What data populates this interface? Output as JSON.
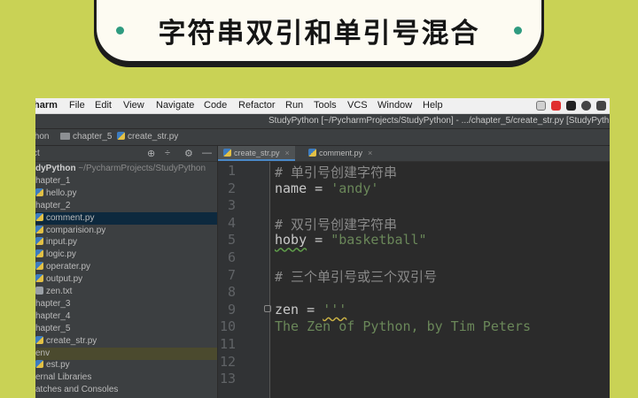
{
  "banner": {
    "title": "字符串双引和单引号混合"
  },
  "menubar": {
    "app": "harm",
    "items": [
      "File",
      "Edit",
      "View",
      "Navigate",
      "Code",
      "Refactor",
      "Run",
      "Tools",
      "VCS",
      "Window",
      "Help"
    ],
    "tray_colors": [
      "#d0d0d0",
      "#e03030",
      "#222222",
      "#444444",
      "#444444"
    ]
  },
  "titlebar": {
    "text": "StudyPython [~/PycharmProjects/StudyPython] - .../chapter_5/create_str.py [StudyPyth"
  },
  "navbar": {
    "crumbs": [
      "thon",
      "chapter_5",
      "create_str.py"
    ]
  },
  "project": {
    "label": "ct",
    "tree": [
      {
        "text": "dyPython",
        "extra": " ~/PycharmProjects/StudyPython",
        "root": true
      },
      {
        "text": "hapter_1",
        "icon": "folder"
      },
      {
        "text": "hello.py",
        "icon": "py"
      },
      {
        "text": "hapter_2",
        "icon": "folder"
      },
      {
        "text": "comment.py",
        "icon": "py",
        "selected": true
      },
      {
        "text": "comparision.py",
        "icon": "py"
      },
      {
        "text": "input.py",
        "icon": "py"
      },
      {
        "text": "logic.py",
        "icon": "py"
      },
      {
        "text": "operater.py",
        "icon": "py"
      },
      {
        "text": "output.py",
        "icon": "py"
      },
      {
        "text": "zen.txt",
        "icon": "txt"
      },
      {
        "text": "hapter_3",
        "icon": "folder"
      },
      {
        "text": "hapter_4",
        "icon": "folder"
      },
      {
        "text": "hapter_5",
        "icon": "folder"
      },
      {
        "text": "create_str.py",
        "icon": "py"
      },
      {
        "text": "env",
        "venv": true
      },
      {
        "text": "est.py",
        "icon": "py"
      },
      {
        "text": "ernal Libraries"
      },
      {
        "text": "atches and Consoles"
      }
    ]
  },
  "tabs": [
    {
      "label": "create_str.py",
      "active": true
    },
    {
      "label": "comment.py",
      "active": false
    }
  ],
  "editor": {
    "line_numbers": [
      "1",
      "2",
      "3",
      "4",
      "5",
      "6",
      "7",
      "8",
      "9",
      "10",
      "11",
      "12",
      "13"
    ],
    "lines": [
      {
        "parts": [
          {
            "t": "# 单引号创建字符串",
            "c": "c-com"
          }
        ]
      },
      {
        "parts": [
          {
            "t": "name = ",
            "c": "c-id"
          },
          {
            "t": "'andy'",
            "c": "c-str"
          }
        ]
      },
      {
        "parts": []
      },
      {
        "parts": [
          {
            "t": "# 双引号创建字符串",
            "c": "c-com"
          }
        ]
      },
      {
        "parts": [
          {
            "t": "hoby",
            "c": "c-id wavy"
          },
          {
            "t": " = ",
            "c": "c-id"
          },
          {
            "t": "\"basketball\"",
            "c": "c-str"
          }
        ]
      },
      {
        "parts": []
      },
      {
        "parts": [
          {
            "t": "# 三个单引号或三个双引号",
            "c": "c-com"
          }
        ]
      },
      {
        "parts": []
      },
      {
        "parts": [
          {
            "t": "zen = ",
            "c": "c-id"
          },
          {
            "t": "'''",
            "c": "c-str wavy-y"
          }
        ]
      },
      {
        "parts": [
          {
            "t": "The Zen of Python, by Tim Peters",
            "c": "c-str"
          }
        ]
      },
      {
        "parts": []
      },
      {
        "parts": []
      },
      {
        "parts": []
      }
    ]
  }
}
